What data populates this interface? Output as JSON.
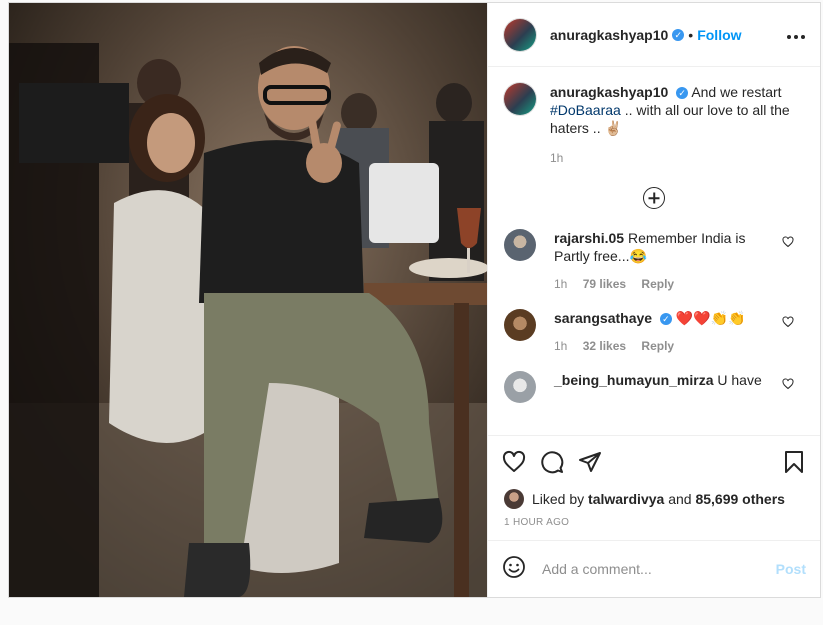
{
  "header": {
    "username": "anuragkashyap10",
    "separator": "•",
    "follow_label": "Follow",
    "more_label": "•••"
  },
  "caption": {
    "username": "anuragkashyap10",
    "text_before": "And we restart",
    "hashtag": "#DoBaaraa",
    "text_after": " .. with all our love to all the haters .. ✌🏼",
    "time": "1h"
  },
  "comments": [
    {
      "username": "rajarshi.05",
      "verified": false,
      "text": "Remember India is Partly free...😂",
      "time": "1h",
      "likes": "79 likes",
      "reply": "Reply",
      "avatar_color": "#5a6470"
    },
    {
      "username": "sarangsathaye",
      "verified": true,
      "text": "❤️❤️👏👏",
      "time": "1h",
      "likes": "32 likes",
      "reply": "Reply",
      "avatar_color": "#7a5a3a"
    },
    {
      "username": "_being_humayun_mirza",
      "verified": false,
      "text": "U have",
      "time": "",
      "likes": "",
      "reply": "",
      "avatar_color": "#9aa0a6"
    }
  ],
  "likes_line": {
    "prefix": "Liked by",
    "user": "talwardivya",
    "middle": "and",
    "others": "85,699 others"
  },
  "time_ago": "1 HOUR AGO",
  "add_comment": {
    "placeholder": "Add a comment...",
    "post_label": "Post"
  },
  "icons": {
    "verified": "verified-badge-icon",
    "heart": "heart-icon",
    "comment": "comment-icon",
    "share": "share-icon",
    "save": "bookmark-icon",
    "emoji": "emoji-icon",
    "load_more": "plus-circle-icon"
  },
  "colors": {
    "link_blue": "#0095f6",
    "verified_blue": "#3897f0",
    "post_disabled": "#b2dffc",
    "muted": "#8e8e8e"
  }
}
